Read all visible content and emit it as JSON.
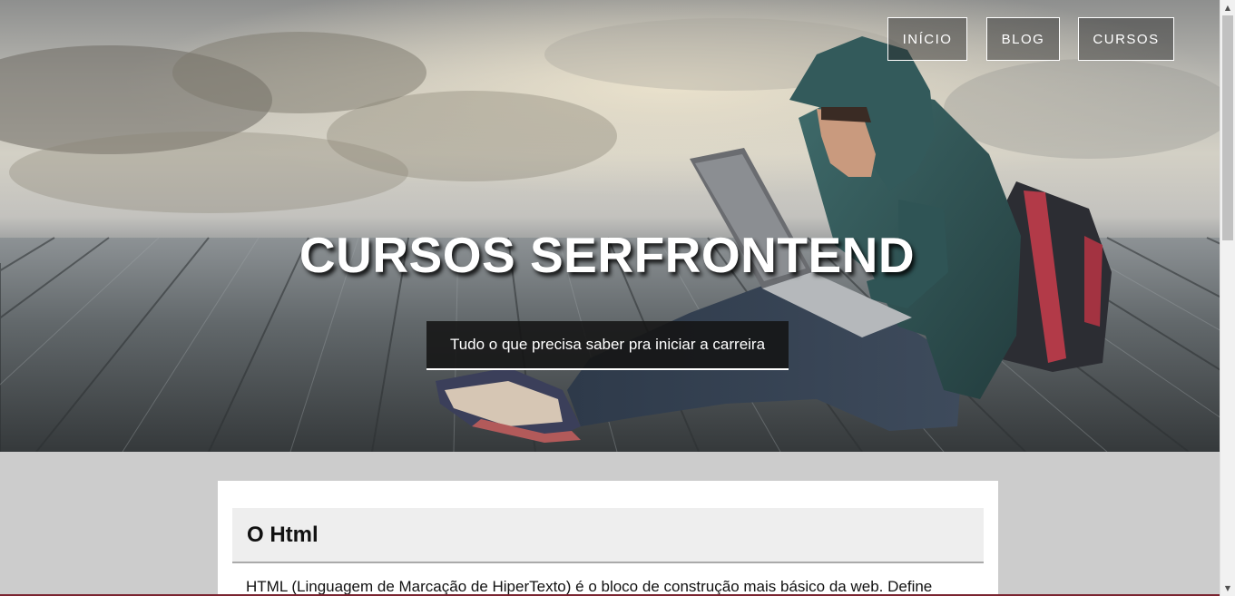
{
  "nav": {
    "items": [
      {
        "label": "INÍCIO"
      },
      {
        "label": "BLOG"
      },
      {
        "label": "CURSOS"
      }
    ]
  },
  "hero": {
    "title": "CURSOS SERFRONTEND",
    "subtitle": "Tudo o que precisa saber pra iniciar a carreira"
  },
  "section": {
    "heading": "O Html",
    "text": "HTML (Linguagem de Marcação de HiperTexto) é o bloco de construção mais básico da web. Define"
  },
  "scrollbar": {
    "up_icon": "chevron-up-icon",
    "down_icon": "chevron-down-icon"
  }
}
